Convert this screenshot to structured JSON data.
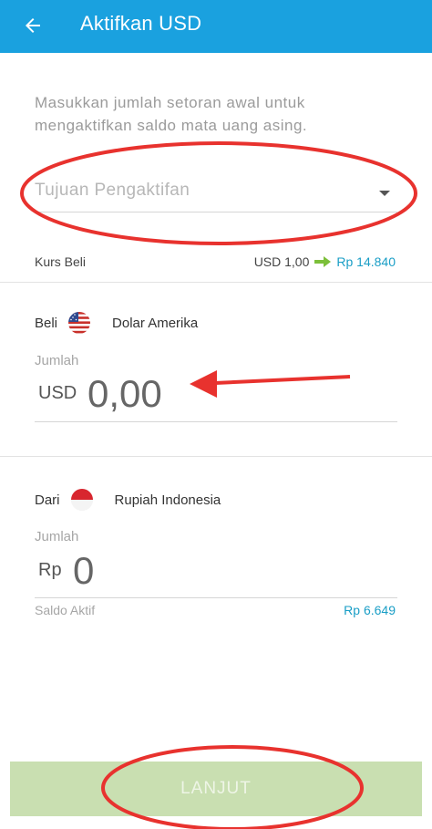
{
  "appbar": {
    "title": "Aktifkan USD",
    "back_icon": "arrow-left-icon"
  },
  "intro": {
    "text": "Masukkan jumlah setoran awal untuk mengaktifkan saldo mata uang asing."
  },
  "purpose_dropdown": {
    "placeholder": "Tujuan Pengaktifan",
    "icon": "caret-down-icon"
  },
  "rate": {
    "label": "Kurs Beli",
    "from": "USD 1,00",
    "to": "Rp 14.840",
    "arrow_icon": "arrow-right-icon",
    "arrow_color": "#7cbf3a"
  },
  "buy": {
    "label": "Beli",
    "currency_name": "Dolar Amerika",
    "flag_icon": "us-flag-icon",
    "amount_label": "Jumlah",
    "currency_code": "USD",
    "amount": "0,00"
  },
  "from": {
    "label": "Dari",
    "currency_name": "Rupiah Indonesia",
    "flag_icon": "indonesia-flag-icon",
    "amount_label": "Jumlah",
    "currency_code": "Rp",
    "amount": "0",
    "balance_label": "Saldo Aktif",
    "balance_value": "Rp 6.649"
  },
  "footer": {
    "next_label": "LANJUT"
  },
  "colors": {
    "appbar": "#1aa1df",
    "accent_link": "#1a9ec6",
    "button_disabled": "#c9dfb1",
    "annotation": "#e8322e"
  }
}
